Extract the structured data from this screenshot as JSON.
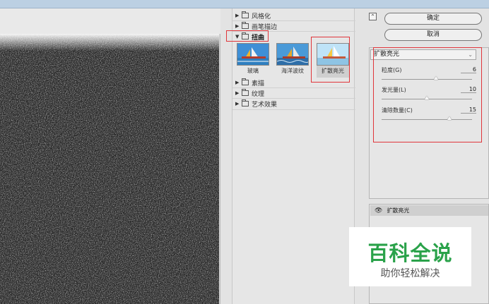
{
  "gallery": {
    "categories": [
      {
        "label": "风格化",
        "open": false
      },
      {
        "label": "画笔描边",
        "open": false
      },
      {
        "label": "扭曲",
        "open": true
      },
      {
        "label": "素描",
        "open": false
      },
      {
        "label": "纹理",
        "open": false
      },
      {
        "label": "艺术效果",
        "open": false
      }
    ],
    "thumbnails": [
      {
        "label": "玻璃"
      },
      {
        "label": "海洋波纹"
      },
      {
        "label": "扩散亮光",
        "selected": true
      }
    ]
  },
  "buttons": {
    "ok": "确定",
    "cancel": "取消",
    "collapse": "⌃"
  },
  "settings": {
    "filter_select": "扩散亮光",
    "params": [
      {
        "label": "粒度(G)",
        "value": "6",
        "fraction": 0.6
      },
      {
        "label": "发光量(L)",
        "value": "10",
        "fraction": 0.5
      },
      {
        "label": "清除数量(C)",
        "value": "15",
        "fraction": 0.75
      }
    ]
  },
  "layers": {
    "active_layer": "扩散亮光"
  },
  "watermark": {
    "title": "百科全说",
    "subtitle": "助你轻松解决"
  },
  "colors": {
    "highlight_box": "#e0353a",
    "watermark_green": "#2aa24a"
  }
}
